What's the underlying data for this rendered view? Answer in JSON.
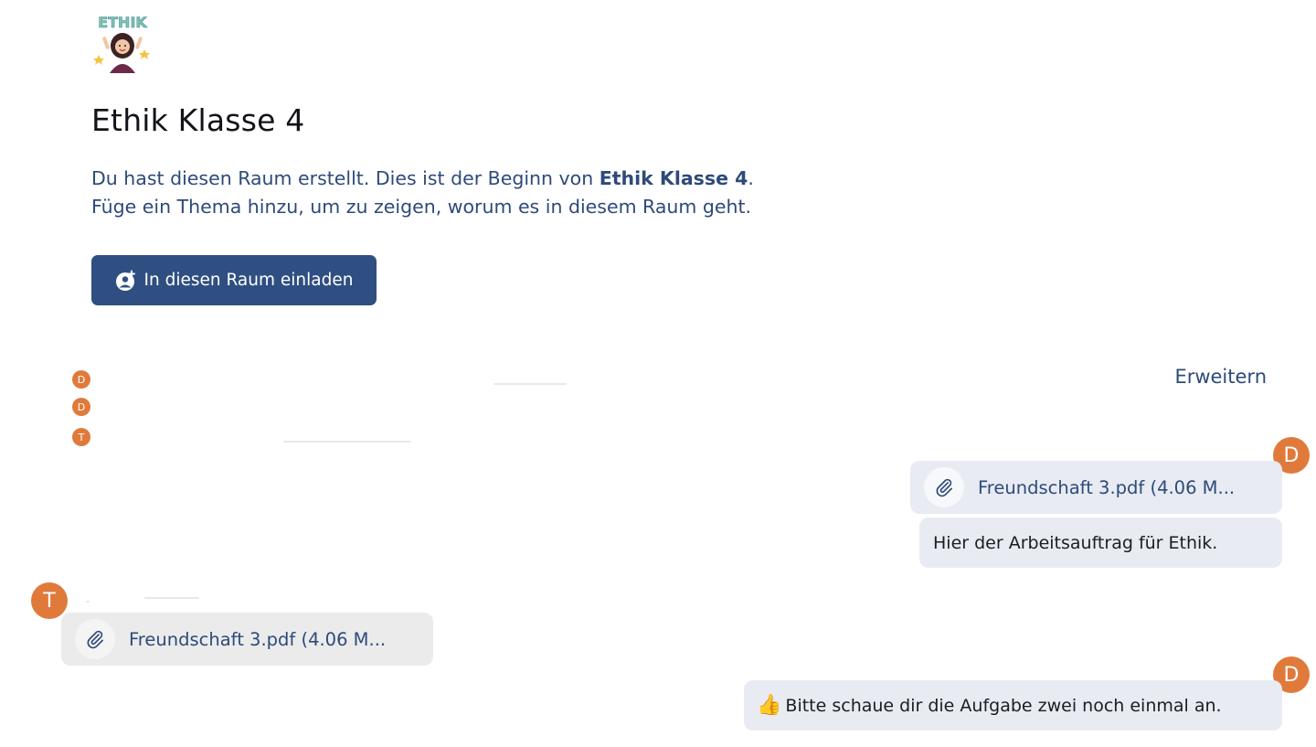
{
  "room": {
    "title": "Ethik Klasse 4",
    "intro_prefix": "Du hast diesen Raum erstellt. Dies ist der Beginn von ",
    "intro_room_name": "Ethik Klasse 4",
    "intro_suffix": ".",
    "intro_line2": "Füge ein Thema hinzu, um zu zeigen, worum es in diesem Raum geht.",
    "invite_label": "In diesen Raum einladen",
    "logo_text": "ETHIK"
  },
  "summary": {
    "avatars": [
      "D",
      "D",
      "T"
    ],
    "expand_label": "Erweitern"
  },
  "messages": [
    {
      "sender_initial": "D",
      "attachment": "Freundschaft 3.pdf (4.06 M...",
      "text": "Hier der Arbeitsauftrag für Ethik."
    },
    {
      "sender_initial": "T",
      "attachment": "Freundschaft 3.pdf (4.06 M..."
    },
    {
      "sender_initial": "D",
      "text": "Bitte schaue dir die Aufgabe zwei noch einmal an."
    }
  ],
  "colors": {
    "accent": "#2f4f82",
    "avatar": "#e07a3b",
    "link": "#2d4a7a",
    "bubble_own": "#e8ebf2",
    "bubble_other": "#ebebeb"
  },
  "icons": {
    "invite": "add-person-icon",
    "attachment": "paperclip-icon",
    "reaction": "thumbs-up-icon"
  }
}
